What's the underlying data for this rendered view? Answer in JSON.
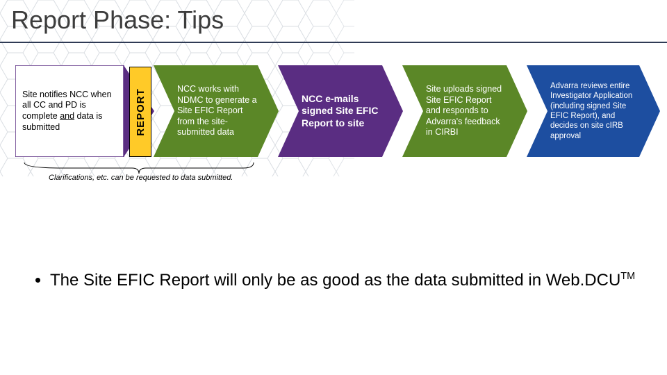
{
  "title": "Report Phase: Tips",
  "report_tab": "REPORT",
  "steps": {
    "s1a": "Site notifies NCC when all CC and PD is complete ",
    "s1b": "and",
    "s1c": " data is submitted",
    "s2": "NCC works with NDMC to generate a Site EFIC Report from the site-submitted data",
    "s3": "NCC e-mails signed Site EFIC Report to site",
    "s4": "Site uploads signed Site EFIC Report and responds to Advarra's feedback in CIRBI",
    "s5": "Advarra reviews entire Investigator Application (including signed Site EFIC Report), and decides on site cIRB approval"
  },
  "clarification": "Clarifications, etc. can be requested to data submitted.",
  "bullet_a": "The Site EFIC Report will only be as good as the data submitted in Web.DCU",
  "bullet_tm": "TM"
}
